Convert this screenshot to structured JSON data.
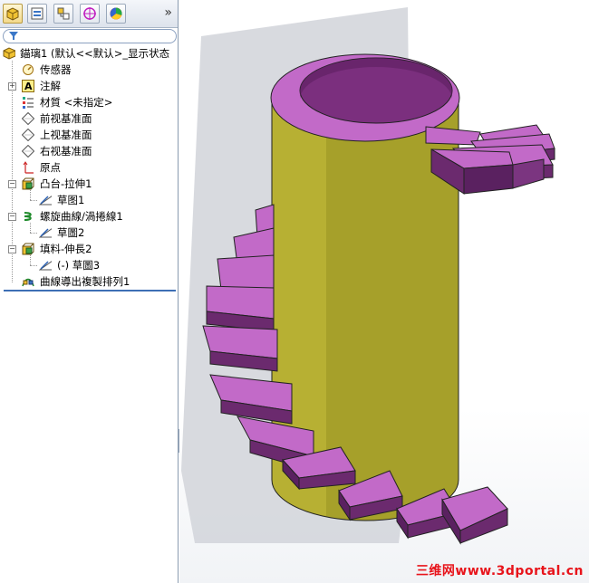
{
  "toolbar": {
    "tabs": [
      {
        "icon": "feature-manager-icon",
        "active": true
      },
      {
        "icon": "property-manager-icon",
        "active": false
      },
      {
        "icon": "configuration-manager-icon",
        "active": false
      },
      {
        "icon": "dimxpert-icon",
        "active": false
      },
      {
        "icon": "display-manager-icon",
        "active": false
      }
    ],
    "more": "»"
  },
  "filter": {
    "icon": "filter-icon"
  },
  "tree": {
    "root": "錨璃1 (默认<<默认>_显示状态",
    "items": [
      {
        "label": "传感器",
        "icon": "sensor-icon"
      },
      {
        "label": "注解",
        "icon": "annotation-icon"
      },
      {
        "label": "材質 <未指定>",
        "icon": "material-icon"
      },
      {
        "label": "前视基准面",
        "icon": "plane-icon"
      },
      {
        "label": "上视基准面",
        "icon": "plane-icon"
      },
      {
        "label": "右视基准面",
        "icon": "plane-icon"
      },
      {
        "label": "原点",
        "icon": "origin-icon"
      },
      {
        "label": "凸台-拉伸1",
        "icon": "extrude-icon"
      },
      {
        "label": "草图1",
        "icon": "sketch-icon"
      },
      {
        "label": "螺旋曲線/渦捲線1",
        "icon": "helix-icon"
      },
      {
        "label": "草圖2",
        "icon": "sketch-icon"
      },
      {
        "label": "填料-伸長2",
        "icon": "extrude-icon"
      },
      {
        "label": "(-) 草圖3",
        "icon": "sketch-icon"
      },
      {
        "label": "曲線導出複製排列1",
        "icon": "curve-pattern-icon"
      }
    ]
  },
  "splitter": {
    "label": "‹‹"
  },
  "colors": {
    "cylinder": "#a8a22a",
    "stairs": "#c264c8",
    "stairs_dark": "#6b2a6e",
    "shadow": "#cfd2d8"
  },
  "watermark": "三维网www.3dportal.cn"
}
